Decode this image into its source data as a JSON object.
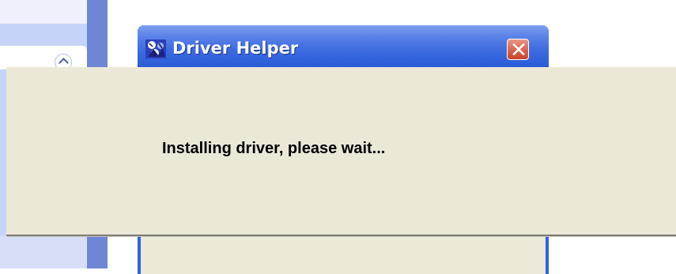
{
  "window": {
    "title": "Driver Helper",
    "icon": "driver-helper-app-icon",
    "close_icon": "close-icon",
    "titlebar_color": "#3b6ae0",
    "close_color": "#d9634a"
  },
  "side_pane": {
    "collapse_icon": "chevron-up-icon"
  },
  "popup": {
    "message": "Installing driver, please wait...",
    "background": "#ebe8d8"
  }
}
